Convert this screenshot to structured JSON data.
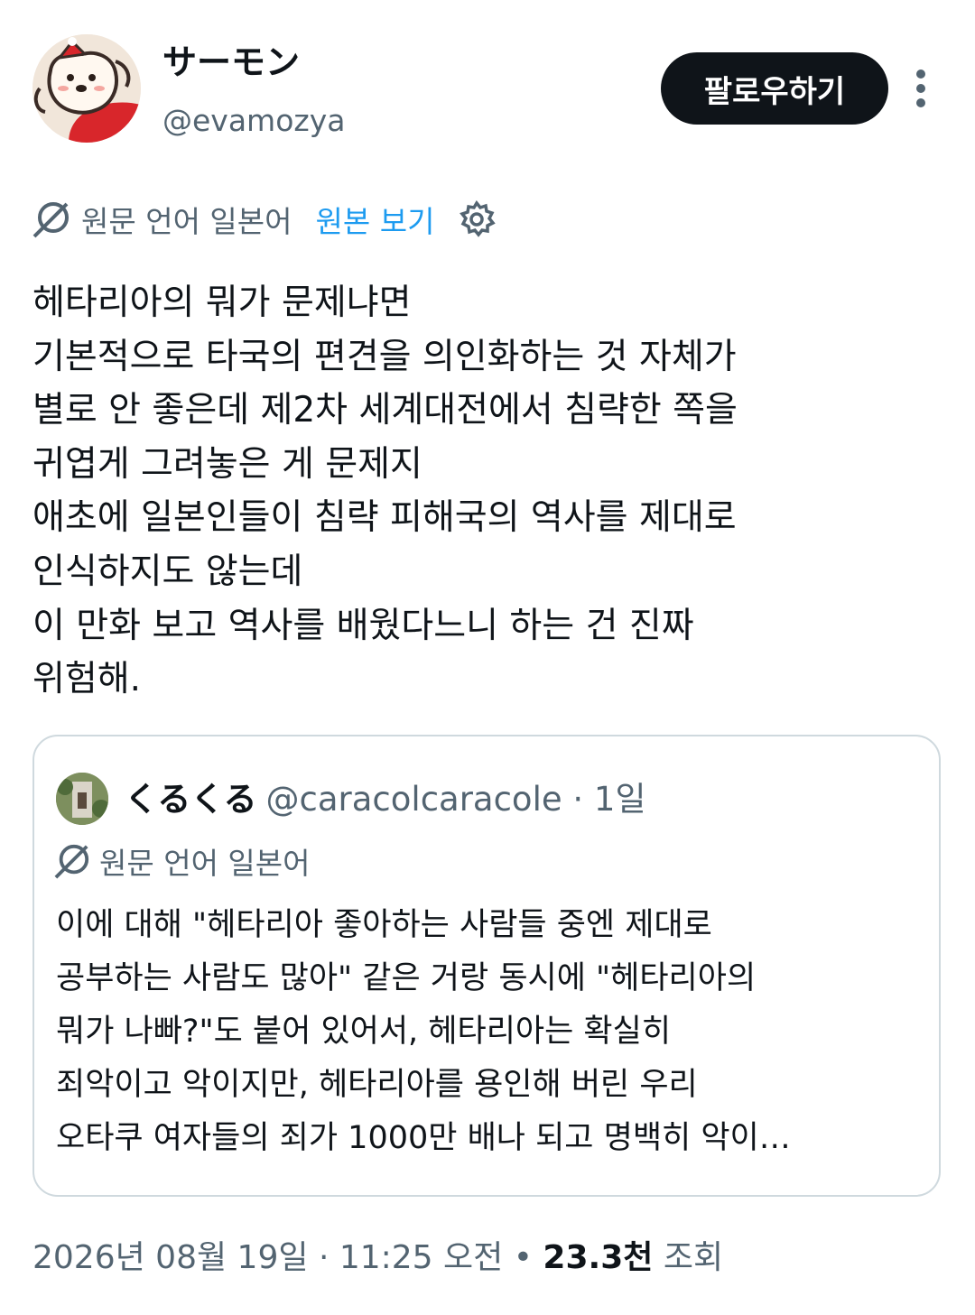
{
  "author": {
    "name": "サーモン",
    "handle": "@evamozya",
    "avatar": "avatar-illustration"
  },
  "follow_button": {
    "label": "팔로우하기"
  },
  "more_icon": "more-vertical-icon",
  "translation": {
    "icon": "translate-icon",
    "label": "원문 언어 일본어",
    "view_original": "원본 보기",
    "settings_icon": "gear-icon"
  },
  "post": {
    "text": "헤타리아의 뭐가 문제냐면\n기본적으로 타국의 편견을 의인화하는 것 자체가\n별로 안 좋은데 제2차 세계대전에서 침략한 쪽을\n귀엽게 그려놓은 게 문제지\n애초에 일본인들이 침략 피해국의 역사를 제대로\n인식하지도 않는데\n이 만화 보고 역사를 배웠다느니 하는 건 진짜\n위험해."
  },
  "quote": {
    "name": "くるくる",
    "handle": "@caracolcaracole",
    "separator": "·",
    "time": "1일",
    "translation_label": "원문 언어 일본어",
    "text": "이에 대해 \"헤타리아 좋아하는 사람들 중엔 제대로\n공부하는 사람도 많아\" 같은 거랑 동시에 \"헤타리아의\n뭐가 나빠?\"도 붙어 있어서, 헤타리아는 확실히\n죄악이고 악이지만, 헤타리아를 용인해 버린 우리\n오타쿠 여자들의 죄가 1000만 배나 되고 명백히 악이…"
  },
  "footer": {
    "date": "2026년 08월 19일",
    "sep1": "·",
    "time": "11:25 오전",
    "sep2": "•",
    "views": "23.3천",
    "views_label": "조회"
  },
  "colors": {
    "text": "#0f1419",
    "secondary": "#536471",
    "link": "#1d9bf0",
    "border": "#cfd9de",
    "button_bg": "#0f1419"
  }
}
